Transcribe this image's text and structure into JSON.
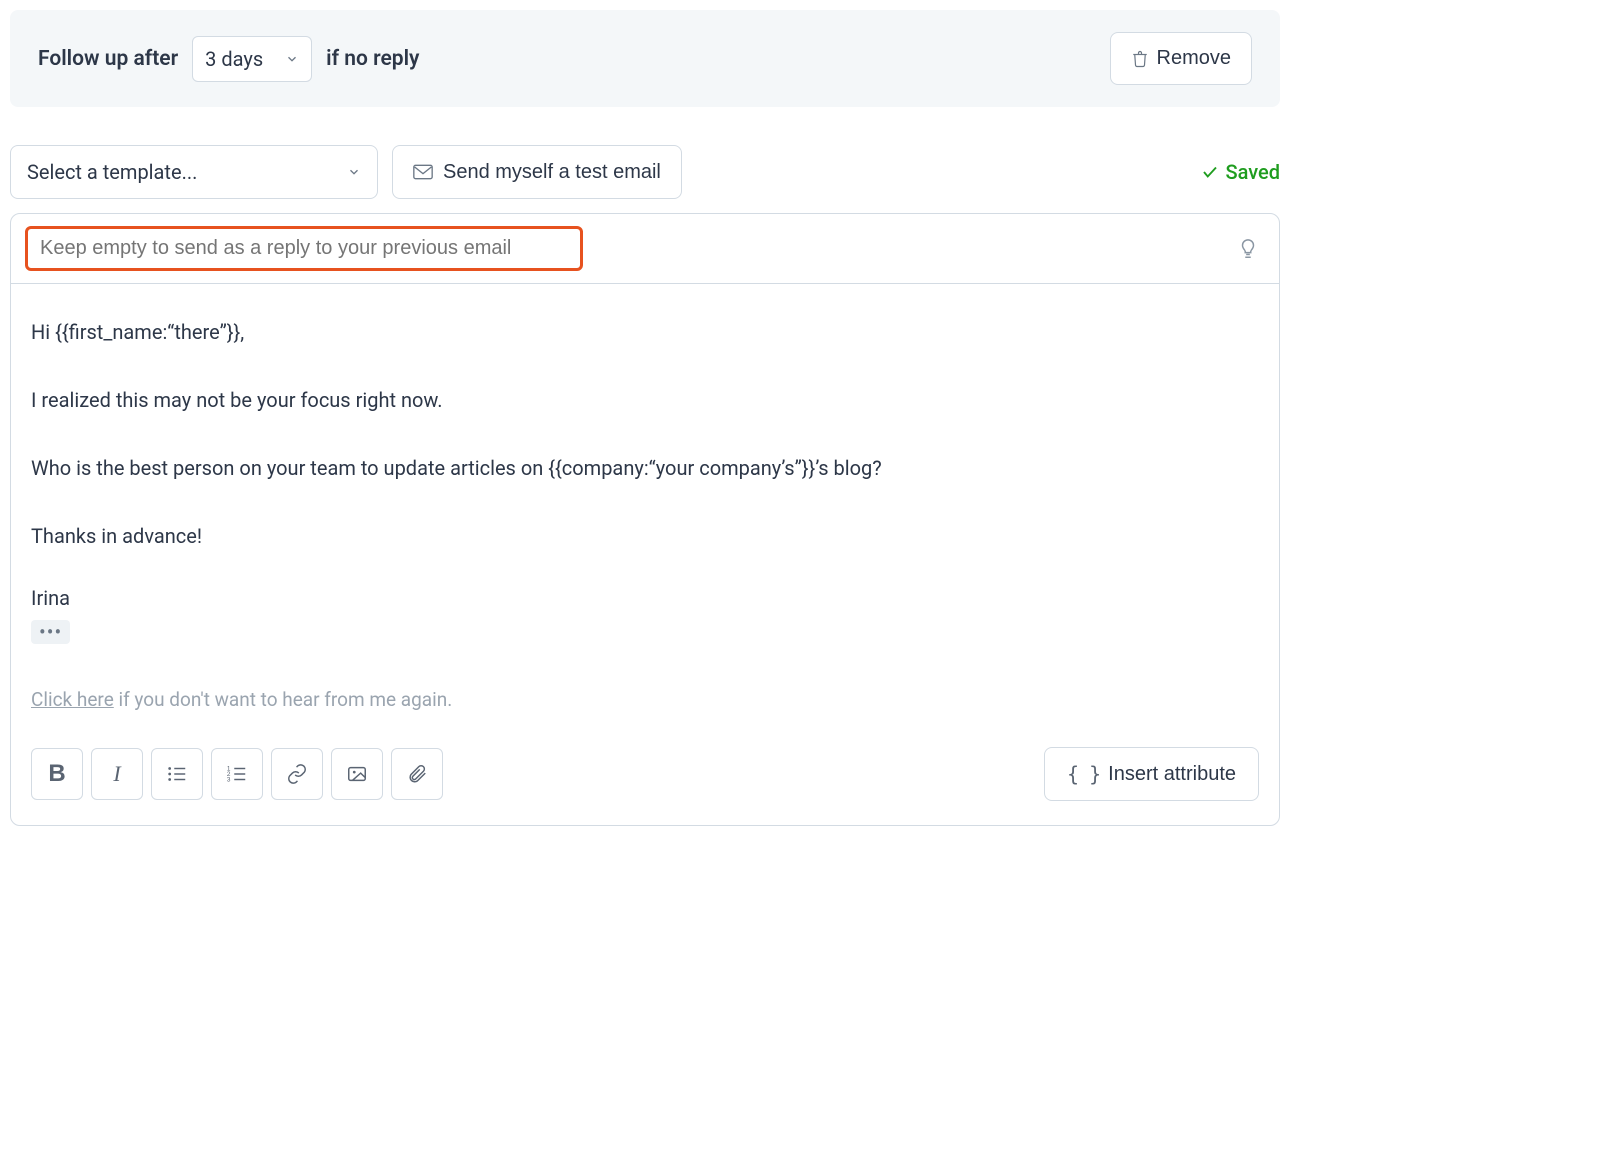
{
  "header": {
    "prefix": "Follow up after",
    "delay_value": "3 days",
    "suffix": "if no reply",
    "remove_label": "Remove"
  },
  "controls": {
    "template_placeholder": "Select a template...",
    "test_email_label": "Send myself a test email",
    "saved_label": "Saved"
  },
  "editor": {
    "subject_placeholder": "Keep empty to send as a reply to your previous email",
    "body": {
      "greeting": "Hi {{first_name:“there”}},",
      "line1": "I realized this may not be your focus right now.",
      "line2": "Who is the best person on your team to update articles on {{company:“your company’s”}}’s blog?",
      "line3": "Thanks in advance!",
      "signature": "Irina",
      "ellipsis": "•••",
      "unsubscribe_link": "Click here",
      "unsubscribe_rest": " if you don't want to hear from me again."
    },
    "toolbar": {
      "insert_attribute_label": "Insert attribute"
    }
  }
}
